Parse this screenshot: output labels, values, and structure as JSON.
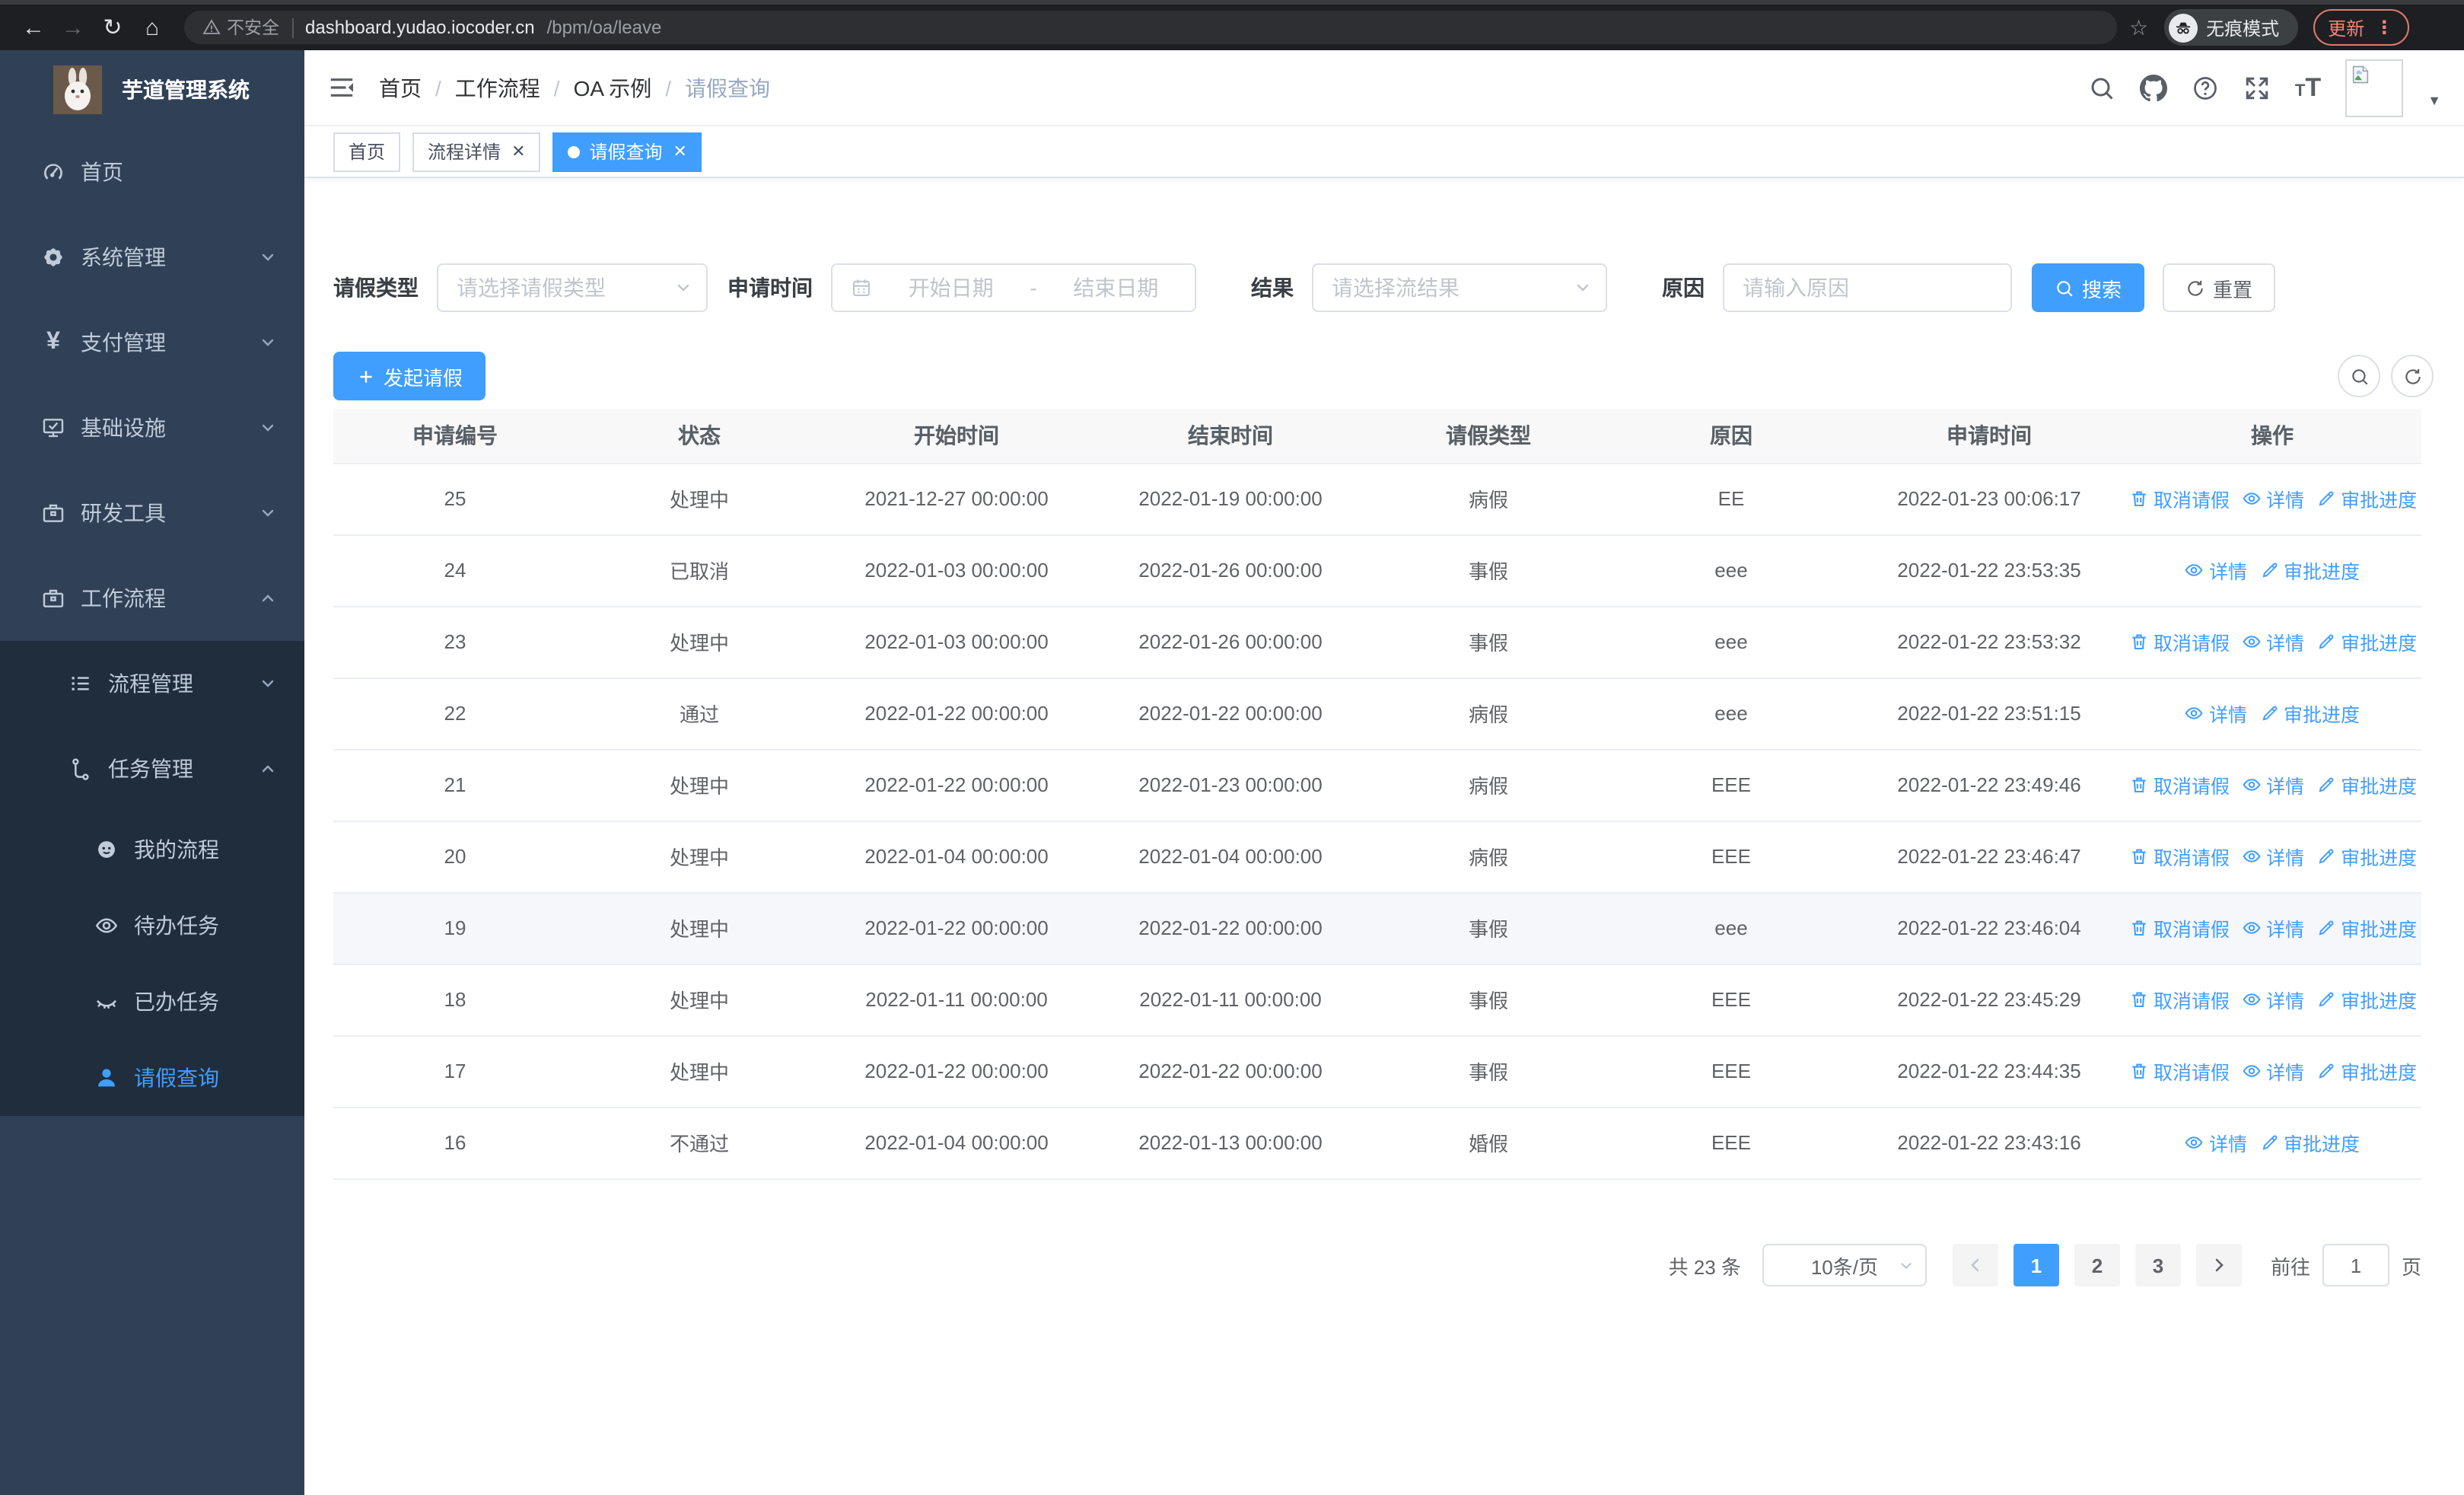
{
  "browser": {
    "security_label": "不安全",
    "url_host": "dashboard.yudao.iocoder.cn",
    "url_path": "/bpm/oa/leave",
    "incognito_label": "无痕模式",
    "update_label": "更新"
  },
  "sidebar": {
    "app_title": "芋道管理系统",
    "items": [
      {
        "label": "首页"
      },
      {
        "label": "系统管理"
      },
      {
        "label": "支付管理"
      },
      {
        "label": "基础设施"
      },
      {
        "label": "研发工具"
      },
      {
        "label": "工作流程"
      }
    ],
    "sub_items": [
      {
        "label": "流程管理"
      },
      {
        "label": "任务管理"
      },
      {
        "label": "我的流程"
      },
      {
        "label": "待办任务"
      },
      {
        "label": "已办任务"
      },
      {
        "label": "请假查询"
      }
    ]
  },
  "header": {
    "breadcrumb": [
      "首页",
      "工作流程",
      "OA 示例",
      "请假查询"
    ]
  },
  "tabs": [
    {
      "label": "首页",
      "closable": false,
      "active": false
    },
    {
      "label": "流程详情",
      "closable": true,
      "active": false
    },
    {
      "label": "请假查询",
      "closable": true,
      "active": true
    }
  ],
  "filters": {
    "leave_type_label": "请假类型",
    "leave_type_placeholder": "请选择请假类型",
    "apply_time_label": "申请时间",
    "start_date_placeholder": "开始日期",
    "range_separator": "-",
    "end_date_placeholder": "结束日期",
    "result_label": "结果",
    "result_placeholder": "请选择流结果",
    "reason_label": "原因",
    "reason_placeholder": "请输入原因",
    "search_button": "搜索",
    "reset_button": "重置"
  },
  "toolbar": {
    "create_button": "发起请假"
  },
  "table": {
    "columns": [
      "申请编号",
      "状态",
      "开始时间",
      "结束时间",
      "请假类型",
      "原因",
      "申请时间",
      "操作"
    ],
    "action_labels": {
      "cancel": "取消请假",
      "detail": "详情",
      "progress": "审批进度"
    },
    "rows": [
      {
        "id": "25",
        "status": "处理中",
        "start": "2021-12-27 00:00:00",
        "end": "2022-01-19 00:00:00",
        "type": "病假",
        "reason": "EE",
        "apply_time": "2022-01-23 00:06:17",
        "actions": [
          "cancel",
          "detail",
          "progress"
        ],
        "highlighted": false
      },
      {
        "id": "24",
        "status": "已取消",
        "start": "2022-01-03 00:00:00",
        "end": "2022-01-26 00:00:00",
        "type": "事假",
        "reason": "eee",
        "apply_time": "2022-01-22 23:53:35",
        "actions": [
          "detail",
          "progress"
        ],
        "highlighted": false
      },
      {
        "id": "23",
        "status": "处理中",
        "start": "2022-01-03 00:00:00",
        "end": "2022-01-26 00:00:00",
        "type": "事假",
        "reason": "eee",
        "apply_time": "2022-01-22 23:53:32",
        "actions": [
          "cancel",
          "detail",
          "progress"
        ],
        "highlighted": false
      },
      {
        "id": "22",
        "status": "通过",
        "start": "2022-01-22 00:00:00",
        "end": "2022-01-22 00:00:00",
        "type": "病假",
        "reason": "eee",
        "apply_time": "2022-01-22 23:51:15",
        "actions": [
          "detail",
          "progress"
        ],
        "highlighted": false
      },
      {
        "id": "21",
        "status": "处理中",
        "start": "2022-01-22 00:00:00",
        "end": "2022-01-23 00:00:00",
        "type": "病假",
        "reason": "EEE",
        "apply_time": "2022-01-22 23:49:46",
        "actions": [
          "cancel",
          "detail",
          "progress"
        ],
        "highlighted": false
      },
      {
        "id": "20",
        "status": "处理中",
        "start": "2022-01-04 00:00:00",
        "end": "2022-01-04 00:00:00",
        "type": "病假",
        "reason": "EEE",
        "apply_time": "2022-01-22 23:46:47",
        "actions": [
          "cancel",
          "detail",
          "progress"
        ],
        "highlighted": false
      },
      {
        "id": "19",
        "status": "处理中",
        "start": "2022-01-22 00:00:00",
        "end": "2022-01-22 00:00:00",
        "type": "事假",
        "reason": "eee",
        "apply_time": "2022-01-22 23:46:04",
        "actions": [
          "cancel",
          "detail",
          "progress"
        ],
        "highlighted": true
      },
      {
        "id": "18",
        "status": "处理中",
        "start": "2022-01-11 00:00:00",
        "end": "2022-01-11 00:00:00",
        "type": "事假",
        "reason": "EEE",
        "apply_time": "2022-01-22 23:45:29",
        "actions": [
          "cancel",
          "detail",
          "progress"
        ],
        "highlighted": false
      },
      {
        "id": "17",
        "status": "处理中",
        "start": "2022-01-22 00:00:00",
        "end": "2022-01-22 00:00:00",
        "type": "事假",
        "reason": "EEE",
        "apply_time": "2022-01-22 23:44:35",
        "actions": [
          "cancel",
          "detail",
          "progress"
        ],
        "highlighted": false
      },
      {
        "id": "16",
        "status": "不通过",
        "start": "2022-01-04 00:00:00",
        "end": "2022-01-13 00:00:00",
        "type": "婚假",
        "reason": "EEE",
        "apply_time": "2022-01-22 23:43:16",
        "actions": [
          "detail",
          "progress"
        ],
        "highlighted": false
      }
    ]
  },
  "pagination": {
    "total_label": "共 23 条",
    "page_size": "10条/页",
    "pages": [
      "1",
      "2",
      "3"
    ],
    "active_page": "1",
    "goto_label": "前往",
    "goto_value": "1",
    "unit_label": "页"
  },
  "colors": {
    "accent": "#409eff",
    "sidebar_bg": "#304156",
    "sidebar_submenu_bg": "#1f2d3d",
    "sidebar_text": "#bfcbd9",
    "table_border": "#ebeef5",
    "table_header_bg": "#f8f8f9",
    "update_button": "#ee8378",
    "browser_bar_bg": "#1e1f22"
  }
}
